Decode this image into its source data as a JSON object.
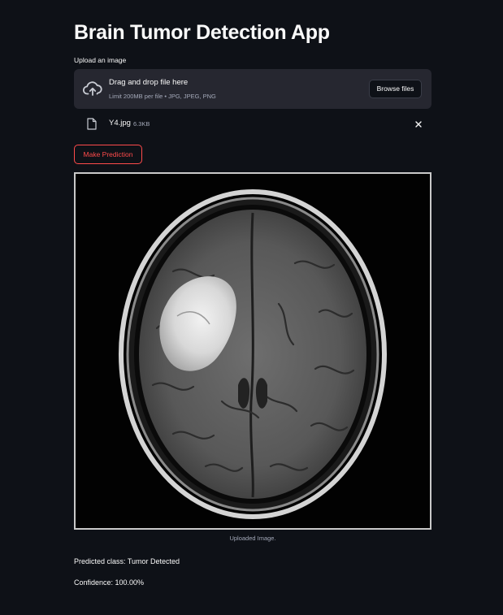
{
  "page": {
    "title": "Brain Tumor Detection App"
  },
  "uploader": {
    "label": "Upload an image",
    "drop_title": "Drag and drop file here",
    "limit_text": "Limit 200MB per file • JPG, JPEG, PNG",
    "browse_label": "Browse files",
    "icon": "cloud-upload-icon"
  },
  "uploaded_file": {
    "name": "Y4.jpg",
    "size": "6.3KB",
    "icon": "file-icon",
    "remove_icon": "close-icon"
  },
  "actions": {
    "predict_label": "Make Prediction"
  },
  "image": {
    "caption": "Uploaded Image."
  },
  "result": {
    "predicted_class": "Predicted class: Tumor Detected",
    "confidence": "Confidence: 100.00%"
  },
  "colors": {
    "background": "#0e1117",
    "surface": "#262730",
    "accent": "#ff4b4b",
    "text": "#fafafa",
    "muted_text": "#a3a8b8"
  }
}
